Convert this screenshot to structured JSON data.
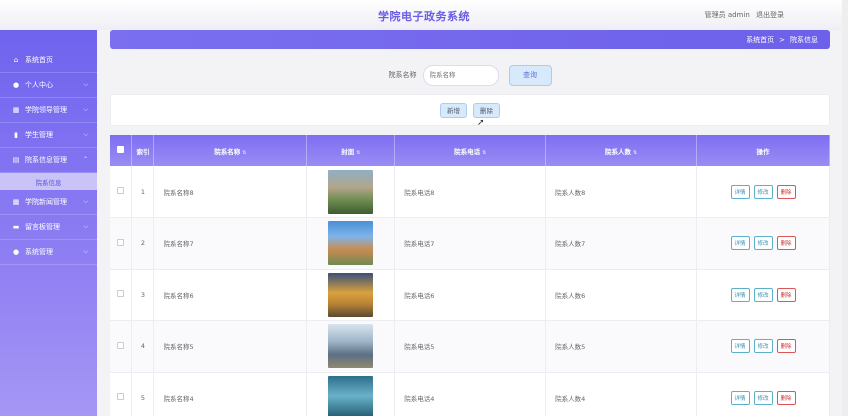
{
  "header": {
    "app_title": "学院电子政务系统",
    "user_label": "管理员 admin",
    "logout_label": "退出登录"
  },
  "breadcrumb": {
    "home": "系统首页",
    "separator": ">",
    "current": "院系信息"
  },
  "sidebar": {
    "items": [
      {
        "label": "系统首页",
        "icon": "home-icon",
        "glyph": "⌂"
      },
      {
        "label": "个人中心",
        "icon": "user-icon",
        "glyph": "●"
      },
      {
        "label": "学院领导管理",
        "icon": "grid-icon",
        "glyph": "▦"
      },
      {
        "label": "学生管理",
        "icon": "book-icon",
        "glyph": "▮"
      },
      {
        "label": "院系信息管理",
        "icon": "doc-icon",
        "glyph": "▤"
      },
      {
        "label": "学院新闻管理",
        "icon": "grid-icon",
        "glyph": "▦"
      },
      {
        "label": "留言板管理",
        "icon": "board-icon",
        "glyph": "▬"
      },
      {
        "label": "系统管理",
        "icon": "user-icon",
        "glyph": "●"
      }
    ],
    "submenu_label": "院系信息"
  },
  "search": {
    "label": "院系名称",
    "placeholder": "院系名称",
    "button_label": "查询"
  },
  "actions": {
    "add_label": "新增",
    "delete_label": "删除"
  },
  "table": {
    "headers": [
      "索引",
      "院系名称",
      "封面",
      "院系电话",
      "院系人数",
      "操作"
    ],
    "rows": [
      {
        "index": "1",
        "name": "院系名称8",
        "phone": "院系电话8",
        "count": "院系人数8"
      },
      {
        "index": "2",
        "name": "院系名称7",
        "phone": "院系电话7",
        "count": "院系人数7"
      },
      {
        "index": "3",
        "name": "院系名称6",
        "phone": "院系电话6",
        "count": "院系人数6"
      },
      {
        "index": "4",
        "name": "院系名称5",
        "phone": "院系电话5",
        "count": "院系人数5"
      },
      {
        "index": "5",
        "name": "院系名称4",
        "phone": "院系电话4",
        "count": "院系人数4"
      }
    ],
    "op_labels": {
      "detail": "详情",
      "edit": "修改",
      "delete": "删除"
    }
  },
  "colors": {
    "accent": "#6a5ce6",
    "sidebar_top": "#6f63ee",
    "danger": "#cc3333",
    "info": "#3a8fb0"
  }
}
